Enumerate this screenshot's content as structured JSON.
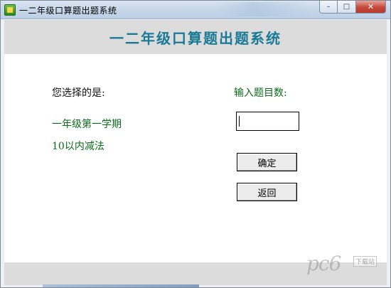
{
  "window": {
    "title": "一二年级口算题出题系统",
    "icon": "app-icon",
    "controls": {
      "minimize": "–",
      "maximize": "□",
      "close": "✕"
    }
  },
  "header": {
    "title": "一二年级口算题出题系统"
  },
  "selection": {
    "label": "您选择的是:",
    "grade": "一年级第一学期",
    "topic": "10以内减法"
  },
  "count": {
    "label": "输入题目数:",
    "value": ""
  },
  "buttons": {
    "confirm": "确定",
    "back": "返回"
  },
  "watermark": {
    "text": "pc6",
    "sub": "下载站"
  },
  "colors": {
    "header_title": "#1a7a96",
    "green_text": "#0d6a1a",
    "band_gray": "#dcdcdc"
  }
}
